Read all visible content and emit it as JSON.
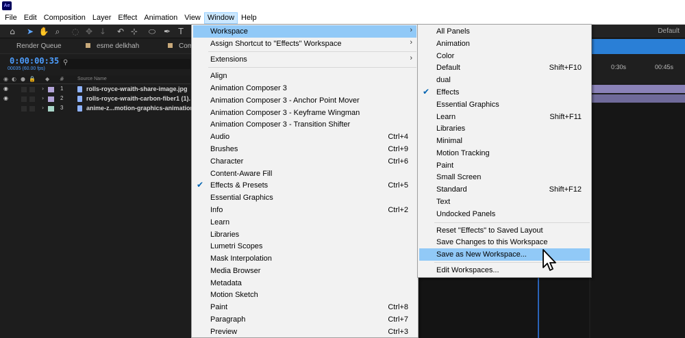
{
  "app": {
    "icon_text": "Ae"
  },
  "menubar": [
    "File",
    "Edit",
    "Composition",
    "Layer",
    "Effect",
    "Animation",
    "View",
    "Window",
    "Help"
  ],
  "toolbar": {
    "workspace_label": "Default"
  },
  "panels": {
    "tabs": [
      {
        "label": "Render Queue"
      },
      {
        "label": "esme delkhah"
      },
      {
        "label": "Com"
      }
    ]
  },
  "timeline": {
    "timecode": "0:00:00:35",
    "fps": "00035 (60.00 fps)",
    "source_header": "Source Name",
    "ruler": [
      "0:30s",
      "00:45s"
    ],
    "layers": [
      {
        "num": "1",
        "name": "rolls-royce-wraith-share-image.jpg",
        "label_color": "#b3a4d9"
      },
      {
        "num": "2",
        "name": "rolls-royce-wraith-carbon-fiber1 (1).",
        "label_color": "#b3a4d9"
      },
      {
        "num": "3",
        "name": "anime-z...motion-graphics-animation",
        "label_color": "#a9d6c8"
      }
    ]
  },
  "window_menu": {
    "items": [
      {
        "label": "Workspace",
        "submenu": true,
        "highlighted": true
      },
      {
        "label": "Assign Shortcut to \"Effects\" Workspace",
        "submenu": true
      },
      {
        "label": "Extensions",
        "submenu": true
      },
      {
        "label": "Align"
      },
      {
        "label": "Animation Composer 3"
      },
      {
        "label": "Animation Composer 3 - Anchor Point Mover"
      },
      {
        "label": "Animation Composer 3 - Keyframe Wingman"
      },
      {
        "label": "Animation Composer 3 - Transition Shifter"
      },
      {
        "label": "Audio",
        "shortcut": "Ctrl+4"
      },
      {
        "label": "Brushes",
        "shortcut": "Ctrl+9"
      },
      {
        "label": "Character",
        "shortcut": "Ctrl+6"
      },
      {
        "label": "Content-Aware Fill"
      },
      {
        "label": "Effects & Presets",
        "shortcut": "Ctrl+5",
        "checked": true
      },
      {
        "label": "Essential Graphics"
      },
      {
        "label": "Info",
        "shortcut": "Ctrl+2"
      },
      {
        "label": "Learn"
      },
      {
        "label": "Libraries"
      },
      {
        "label": "Lumetri Scopes"
      },
      {
        "label": "Mask Interpolation"
      },
      {
        "label": "Media Browser"
      },
      {
        "label": "Metadata"
      },
      {
        "label": "Motion Sketch"
      },
      {
        "label": "Paint",
        "shortcut": "Ctrl+8"
      },
      {
        "label": "Paragraph",
        "shortcut": "Ctrl+7"
      },
      {
        "label": "Preview",
        "shortcut": "Ctrl+3"
      }
    ]
  },
  "workspace_menu": {
    "items": [
      {
        "label": "All Panels"
      },
      {
        "label": "Animation"
      },
      {
        "label": "Color"
      },
      {
        "label": "Default",
        "shortcut": "Shift+F10"
      },
      {
        "label": "dual"
      },
      {
        "label": "Effects",
        "checked": true
      },
      {
        "label": "Essential Graphics"
      },
      {
        "label": "Learn",
        "shortcut": "Shift+F11"
      },
      {
        "label": "Libraries"
      },
      {
        "label": "Minimal"
      },
      {
        "label": "Motion Tracking"
      },
      {
        "label": "Paint"
      },
      {
        "label": "Small Screen"
      },
      {
        "label": "Standard",
        "shortcut": "Shift+F12"
      },
      {
        "label": "Text"
      },
      {
        "label": "Undocked Panels"
      },
      {
        "label": "Reset \"Effects\" to Saved Layout"
      },
      {
        "label": "Save Changes to this Workspace"
      },
      {
        "label": "Save as New Workspace...",
        "highlighted": true
      },
      {
        "label": "Edit Workspaces..."
      }
    ]
  },
  "colors": {
    "accent": "#2a7fd6",
    "menu_highlight": "#91c9f7",
    "timecode": "#4d9eff"
  }
}
